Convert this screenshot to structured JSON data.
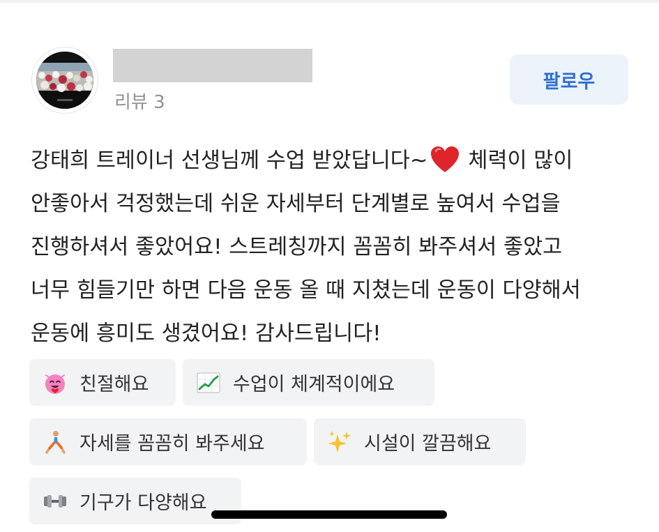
{
  "reviewer": {
    "review_count": "리뷰 3",
    "follow_label": "팔로우"
  },
  "review": {
    "lines": [
      "강태희 트레이너 선생님께 수업 받았답니다~",
      "체력이 많이",
      "안좋아서 걱정했는데 쉬운 자세부터 단계별로 높여서 수업을",
      "진행하셔서 좋았어요! 스트레칭까지 꼼꼼히 봐주셔서 좋았고",
      "너무 힘들기만 하면 다음 운동 올 때 지쳤는데 운동이 다양해서",
      "운동에 흥미도 생겼어요! 감사드립니다!"
    ]
  },
  "tags": [
    {
      "icon": "smiling-heart-face-icon",
      "label": "친절해요"
    },
    {
      "icon": "chart-increasing-icon",
      "label": "수업이 체계적이에요"
    },
    {
      "icon": "lunge-person-icon",
      "label": "자세를 꼼꼼히 봐주세요"
    },
    {
      "icon": "sparkles-icon",
      "label": "시설이 깔끔해요"
    },
    {
      "icon": "dumbbell-icon",
      "label": "기구가 다양해요"
    }
  ],
  "colors": {
    "accent": "#2f6fd1",
    "follow_bg": "#edf3fb",
    "tag_bg": "#f2f3f5",
    "muted_text": "#8e9297",
    "heart": "#e0242b"
  }
}
